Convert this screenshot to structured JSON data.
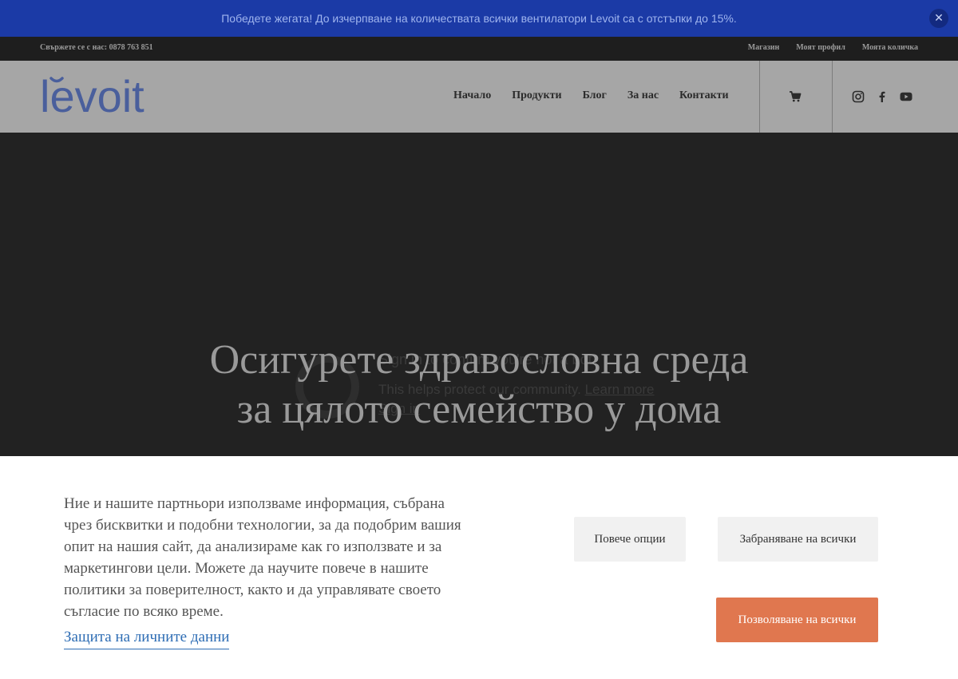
{
  "promo": {
    "text": "Победете жегата! До изчерпване на количествата всички вентилатори Levoit са с отстъпки до 15%.",
    "close_glyph": "✕"
  },
  "topbar": {
    "contact": "Свържете се с нас: 0878 763 851",
    "links": [
      "Магазин",
      "Моят профил",
      "Моята количка"
    ]
  },
  "header": {
    "logo_text": "levoit",
    "nav": [
      "Начало",
      "Продукти",
      "Блог",
      "За нас",
      "Контакти"
    ],
    "icons": [
      "cart-icon",
      "instagram-icon",
      "facebook-icon",
      "youtube-icon"
    ]
  },
  "hero": {
    "title_line1": "Осигурете здравословна среда",
    "title_line2": "за цялото семейство у дома",
    "overlay_line1": "Sign in to confirm you're not a bot",
    "overlay_line2_prefix": "This helps protect our community.",
    "overlay_line2_link": "Learn more",
    "overlay_line3": "Sign in"
  },
  "cookie": {
    "text": "Ние и нашите партньори използваме информация, събрана чрез бисквитки и подобни технологии, за да подобрим вашия опит на нашия сайт, да анализираме как го използвате и за маркетингови цели. Можете да научите повече в нашите политики за поверителност, както и да управлявате своето съгласие по всяко време.",
    "link": "Защита на личните данни",
    "more_button": "Повече опции",
    "deny_button": "Забраняване на всички",
    "allow_button": "Позволяване на всички"
  },
  "colors": {
    "promo_bg": "#1b3aa6",
    "logo": "#4a5f9c",
    "allow_button": "#e0774f",
    "link": "#2e6db4"
  }
}
